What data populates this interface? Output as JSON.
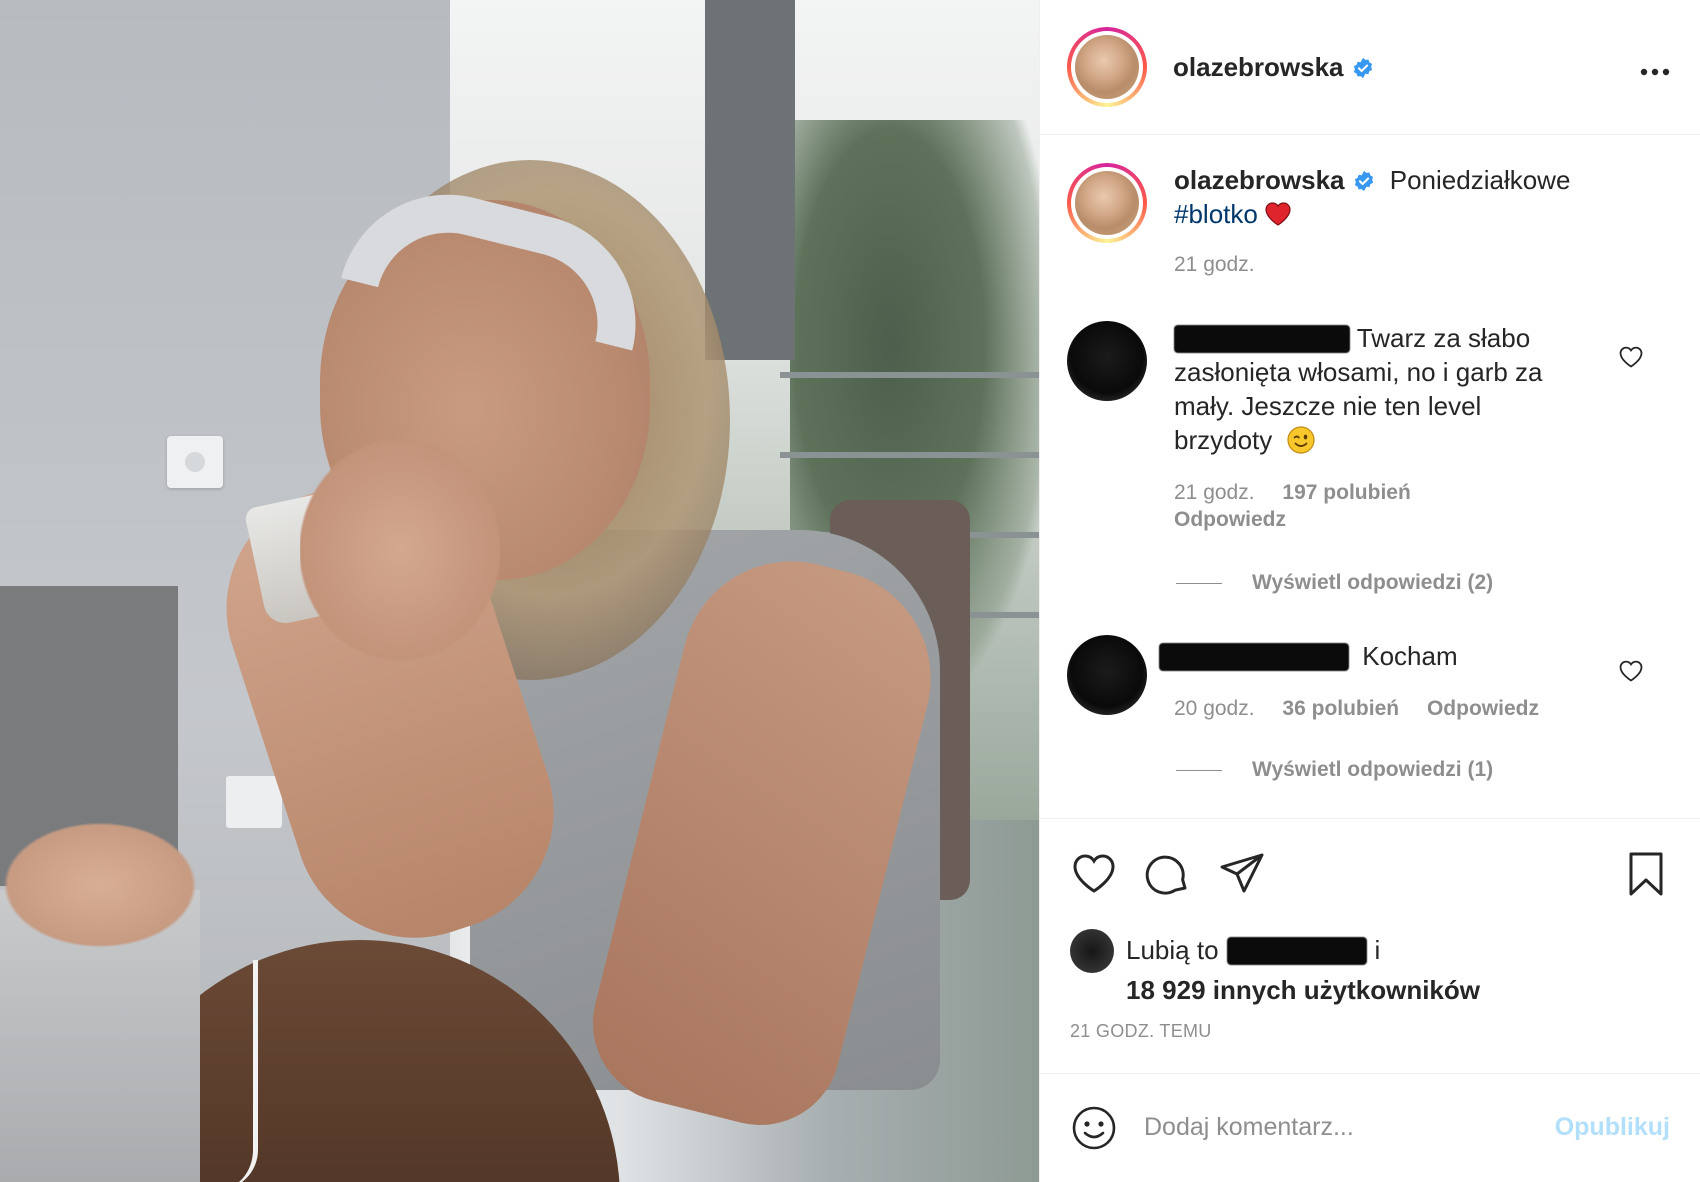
{
  "post": {
    "author": "olazebrowska",
    "verified": true
  },
  "caption": {
    "author": "olazebrowska",
    "text_before_tag": "Poniedziałkowe",
    "hashtag": "#blotko",
    "emoji": "heart",
    "time": "21 godz."
  },
  "comments": [
    {
      "text_line1": "Twarz za słabo",
      "text_line2": "zasłonięta włosami, no i garb za",
      "text_line3": "mały. Jeszcze nie ten level",
      "text_line4": "brzydoty",
      "emoji": "winking-face",
      "time": "21 godz.",
      "likes": "197 polubień",
      "reply_label": "Odpowiedz",
      "view_replies": "Wyświetl odpowiedzi (2)"
    },
    {
      "text_line1": "Kocham",
      "time": "20 godz.",
      "likes": "36 polubień",
      "reply_label": "Odpowiedz",
      "view_replies": "Wyświetl odpowiedzi (1)"
    }
  ],
  "likes": {
    "prefix": "Lubią to",
    "suffix": "i",
    "count_text": "18 929 innych użytkowników"
  },
  "timestamp": "21 GODZ. TEMU",
  "add_comment": {
    "placeholder": "Dodaj komentarz...",
    "publish_label": "Opublikuj"
  },
  "colors": {
    "verified": "#3897f0",
    "hashtag": "#00376b",
    "publish_disabled": "#b2dffc",
    "heart": "#ed4956"
  },
  "icons": [
    "more-icon",
    "verified-icon",
    "heart-icon",
    "comment-icon",
    "share-icon",
    "bookmark-icon",
    "emoji-icon",
    "small-heart-icon"
  ]
}
